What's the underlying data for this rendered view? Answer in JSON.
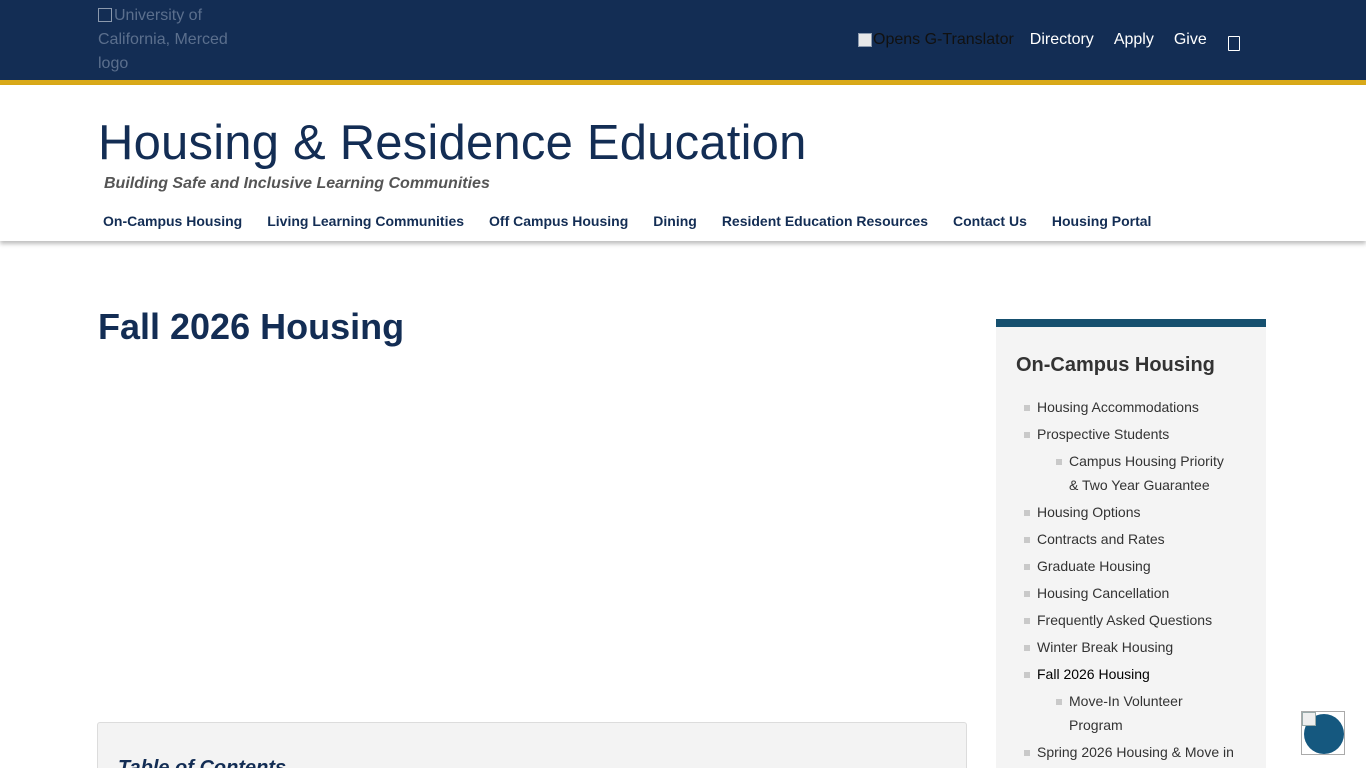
{
  "topbar": {
    "logo_alt": "University of California, Merced logo",
    "translator_alt": "Opens G-Translator",
    "links": [
      "Directory",
      "Apply",
      "Give"
    ],
    "search_icon": "search-icon"
  },
  "header": {
    "title": "Housing & Residence Education",
    "tagline": "Building Safe and Inclusive Learning Communities",
    "nav": [
      "On-Campus Housing",
      "Living Learning Communities",
      "Off Campus Housing",
      "Dining",
      "Resident Education Resources",
      "Contact Us",
      "Housing Portal"
    ]
  },
  "main": {
    "page_title": "Fall 2026 Housing",
    "toc_title": "Table of Contents"
  },
  "sidebar": {
    "title": "On-Campus Housing",
    "items": [
      {
        "label": "Housing Accommodations",
        "level": 1
      },
      {
        "label": "Prospective Students",
        "level": 1
      },
      {
        "label": "Campus Housing Priority & Two Year Guarantee",
        "level": 2
      },
      {
        "label": "Housing Options",
        "level": 1
      },
      {
        "label": "Contracts and Rates",
        "level": 1
      },
      {
        "label": "Graduate Housing",
        "level": 1
      },
      {
        "label": "Housing Cancellation",
        "level": 1
      },
      {
        "label": "Frequently Asked Questions",
        "level": 1
      },
      {
        "label": "Winter Break Housing",
        "level": 1
      },
      {
        "label": "Fall 2026 Housing",
        "level": 1,
        "active": true
      },
      {
        "label": "Move-In Volunteer Program",
        "level": 2
      },
      {
        "label": "Spring 2026 Housing & Move in",
        "level": 1
      }
    ]
  },
  "colors": {
    "navy": "#132d54",
    "gold": "#d9a919",
    "sidebar_accent": "#16506f"
  }
}
